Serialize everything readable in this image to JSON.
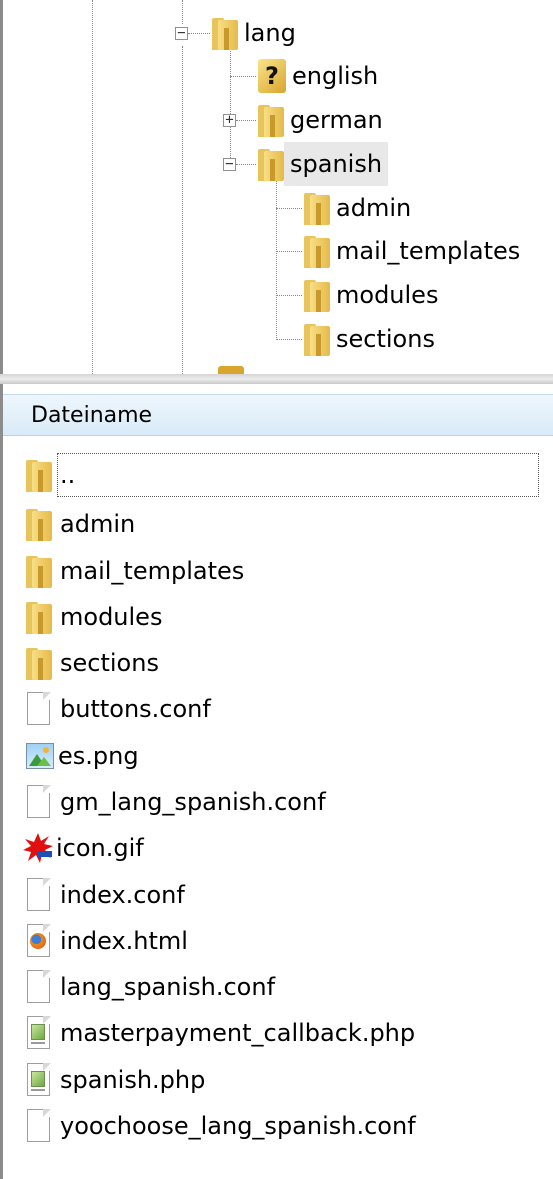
{
  "tree": {
    "nodes": [
      {
        "label": "lang",
        "icon": "folder-icon",
        "expander": "−"
      },
      {
        "label": "english",
        "icon": "question-icon"
      },
      {
        "label": "german",
        "icon": "folder-icon",
        "expander": "+"
      },
      {
        "label": "spanish",
        "icon": "folder-icon",
        "expander": "−",
        "selected": true
      },
      {
        "label": "admin",
        "icon": "folder-icon"
      },
      {
        "label": "mail_templates",
        "icon": "folder-icon"
      },
      {
        "label": "modules",
        "icon": "folder-icon"
      },
      {
        "label": "sections",
        "icon": "folder-icon"
      }
    ]
  },
  "file_list": {
    "column_header": "Dateiname",
    "rows": [
      {
        "name": "..",
        "icon": "folder-icon"
      },
      {
        "name": "admin",
        "icon": "folder-icon"
      },
      {
        "name": "mail_templates",
        "icon": "folder-icon"
      },
      {
        "name": "modules",
        "icon": "folder-icon"
      },
      {
        "name": "sections",
        "icon": "folder-icon"
      },
      {
        "name": "buttons.conf",
        "icon": "document-icon"
      },
      {
        "name": "es.png",
        "icon": "image-icon"
      },
      {
        "name": "gm_lang_spanish.conf",
        "icon": "document-icon"
      },
      {
        "name": "icon.gif",
        "icon": "gif-splat-icon"
      },
      {
        "name": "index.conf",
        "icon": "document-icon"
      },
      {
        "name": "index.html",
        "icon": "firefox-html-icon"
      },
      {
        "name": "lang_spanish.conf",
        "icon": "document-icon"
      },
      {
        "name": "masterpayment_callback.php",
        "icon": "php-file-icon"
      },
      {
        "name": "spanish.php",
        "icon": "php-file-icon"
      },
      {
        "name": "yoochoose_lang_spanish.conf",
        "icon": "document-icon"
      }
    ]
  },
  "colors": {
    "header_gradient_top": "#eef6fc",
    "header_gradient_bottom": "#d9ebf8",
    "selection_bg": "#e8e8e8",
    "folder_yellow": "#e6b94a"
  }
}
